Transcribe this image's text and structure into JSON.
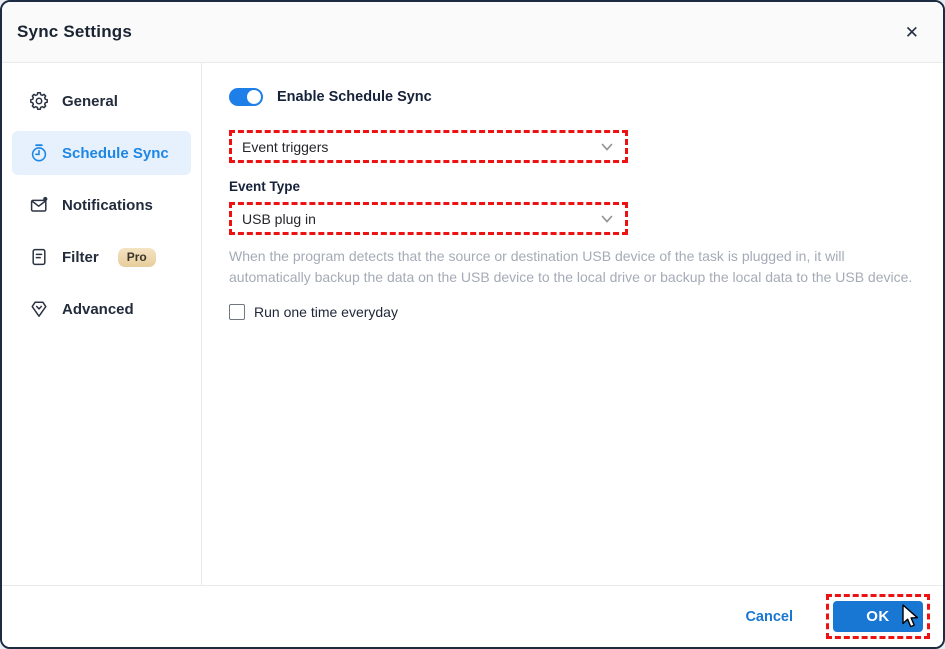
{
  "dialog": {
    "title": "Sync Settings",
    "close_glyph": "✕"
  },
  "sidebar": {
    "items": [
      {
        "label": "General",
        "icon": "gear-icon",
        "active": false
      },
      {
        "label": "Schedule Sync",
        "icon": "stopwatch-icon",
        "active": true
      },
      {
        "label": "Notifications",
        "icon": "mail-dot-icon",
        "active": false
      },
      {
        "label": "Filter",
        "icon": "document-icon",
        "active": false,
        "badge": "Pro"
      },
      {
        "label": "Advanced",
        "icon": "diamond-icon",
        "active": false
      }
    ]
  },
  "main": {
    "toggle_label": "Enable Schedule Sync",
    "toggle_on": true,
    "schedule_mode_value": "Event triggers",
    "event_type_label": "Event Type",
    "event_type_value": "USB plug in",
    "description": "When the program detects that the source or destination USB device of the task is plugged in, it will automatically backup the data on the USB device to the local drive or backup the local data to the USB device.",
    "checkbox_label": "Run one time everyday",
    "checkbox_checked": false
  },
  "footer": {
    "cancel_label": "Cancel",
    "ok_label": "OK"
  },
  "colors": {
    "accent_blue": "#1877d2",
    "toggle_blue": "#1f7fe8",
    "active_item_text": "#1e87e5",
    "active_item_bg": "#e7f1fd",
    "annotation_red": "#ee1111",
    "pro_badge_bg": "#ecd6a8",
    "description_gray": "#a5abb6",
    "dialog_border": "#1c2a42"
  }
}
